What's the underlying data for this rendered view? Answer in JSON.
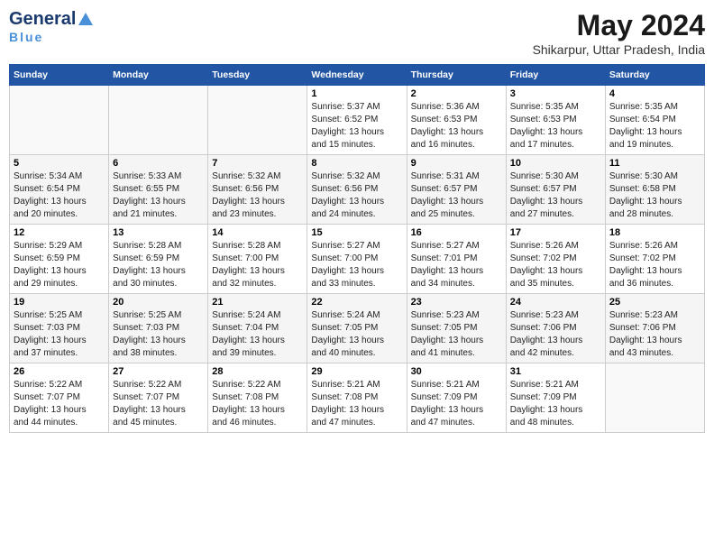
{
  "header": {
    "logo_general": "General",
    "logo_blue": "Blue",
    "month_year": "May 2024",
    "location": "Shikarpur, Uttar Pradesh, India"
  },
  "weekdays": [
    "Sunday",
    "Monday",
    "Tuesday",
    "Wednesday",
    "Thursday",
    "Friday",
    "Saturday"
  ],
  "weeks": [
    [
      {
        "day": "",
        "info": ""
      },
      {
        "day": "",
        "info": ""
      },
      {
        "day": "",
        "info": ""
      },
      {
        "day": "1",
        "info": "Sunrise: 5:37 AM\nSunset: 6:52 PM\nDaylight: 13 hours\nand 15 minutes."
      },
      {
        "day": "2",
        "info": "Sunrise: 5:36 AM\nSunset: 6:53 PM\nDaylight: 13 hours\nand 16 minutes."
      },
      {
        "day": "3",
        "info": "Sunrise: 5:35 AM\nSunset: 6:53 PM\nDaylight: 13 hours\nand 17 minutes."
      },
      {
        "day": "4",
        "info": "Sunrise: 5:35 AM\nSunset: 6:54 PM\nDaylight: 13 hours\nand 19 minutes."
      }
    ],
    [
      {
        "day": "5",
        "info": "Sunrise: 5:34 AM\nSunset: 6:54 PM\nDaylight: 13 hours\nand 20 minutes."
      },
      {
        "day": "6",
        "info": "Sunrise: 5:33 AM\nSunset: 6:55 PM\nDaylight: 13 hours\nand 21 minutes."
      },
      {
        "day": "7",
        "info": "Sunrise: 5:32 AM\nSunset: 6:56 PM\nDaylight: 13 hours\nand 23 minutes."
      },
      {
        "day": "8",
        "info": "Sunrise: 5:32 AM\nSunset: 6:56 PM\nDaylight: 13 hours\nand 24 minutes."
      },
      {
        "day": "9",
        "info": "Sunrise: 5:31 AM\nSunset: 6:57 PM\nDaylight: 13 hours\nand 25 minutes."
      },
      {
        "day": "10",
        "info": "Sunrise: 5:30 AM\nSunset: 6:57 PM\nDaylight: 13 hours\nand 27 minutes."
      },
      {
        "day": "11",
        "info": "Sunrise: 5:30 AM\nSunset: 6:58 PM\nDaylight: 13 hours\nand 28 minutes."
      }
    ],
    [
      {
        "day": "12",
        "info": "Sunrise: 5:29 AM\nSunset: 6:59 PM\nDaylight: 13 hours\nand 29 minutes."
      },
      {
        "day": "13",
        "info": "Sunrise: 5:28 AM\nSunset: 6:59 PM\nDaylight: 13 hours\nand 30 minutes."
      },
      {
        "day": "14",
        "info": "Sunrise: 5:28 AM\nSunset: 7:00 PM\nDaylight: 13 hours\nand 32 minutes."
      },
      {
        "day": "15",
        "info": "Sunrise: 5:27 AM\nSunset: 7:00 PM\nDaylight: 13 hours\nand 33 minutes."
      },
      {
        "day": "16",
        "info": "Sunrise: 5:27 AM\nSunset: 7:01 PM\nDaylight: 13 hours\nand 34 minutes."
      },
      {
        "day": "17",
        "info": "Sunrise: 5:26 AM\nSunset: 7:02 PM\nDaylight: 13 hours\nand 35 minutes."
      },
      {
        "day": "18",
        "info": "Sunrise: 5:26 AM\nSunset: 7:02 PM\nDaylight: 13 hours\nand 36 minutes."
      }
    ],
    [
      {
        "day": "19",
        "info": "Sunrise: 5:25 AM\nSunset: 7:03 PM\nDaylight: 13 hours\nand 37 minutes."
      },
      {
        "day": "20",
        "info": "Sunrise: 5:25 AM\nSunset: 7:03 PM\nDaylight: 13 hours\nand 38 minutes."
      },
      {
        "day": "21",
        "info": "Sunrise: 5:24 AM\nSunset: 7:04 PM\nDaylight: 13 hours\nand 39 minutes."
      },
      {
        "day": "22",
        "info": "Sunrise: 5:24 AM\nSunset: 7:05 PM\nDaylight: 13 hours\nand 40 minutes."
      },
      {
        "day": "23",
        "info": "Sunrise: 5:23 AM\nSunset: 7:05 PM\nDaylight: 13 hours\nand 41 minutes."
      },
      {
        "day": "24",
        "info": "Sunrise: 5:23 AM\nSunset: 7:06 PM\nDaylight: 13 hours\nand 42 minutes."
      },
      {
        "day": "25",
        "info": "Sunrise: 5:23 AM\nSunset: 7:06 PM\nDaylight: 13 hours\nand 43 minutes."
      }
    ],
    [
      {
        "day": "26",
        "info": "Sunrise: 5:22 AM\nSunset: 7:07 PM\nDaylight: 13 hours\nand 44 minutes."
      },
      {
        "day": "27",
        "info": "Sunrise: 5:22 AM\nSunset: 7:07 PM\nDaylight: 13 hours\nand 45 minutes."
      },
      {
        "day": "28",
        "info": "Sunrise: 5:22 AM\nSunset: 7:08 PM\nDaylight: 13 hours\nand 46 minutes."
      },
      {
        "day": "29",
        "info": "Sunrise: 5:21 AM\nSunset: 7:08 PM\nDaylight: 13 hours\nand 47 minutes."
      },
      {
        "day": "30",
        "info": "Sunrise: 5:21 AM\nSunset: 7:09 PM\nDaylight: 13 hours\nand 47 minutes."
      },
      {
        "day": "31",
        "info": "Sunrise: 5:21 AM\nSunset: 7:09 PM\nDaylight: 13 hours\nand 48 minutes."
      },
      {
        "day": "",
        "info": ""
      }
    ]
  ]
}
